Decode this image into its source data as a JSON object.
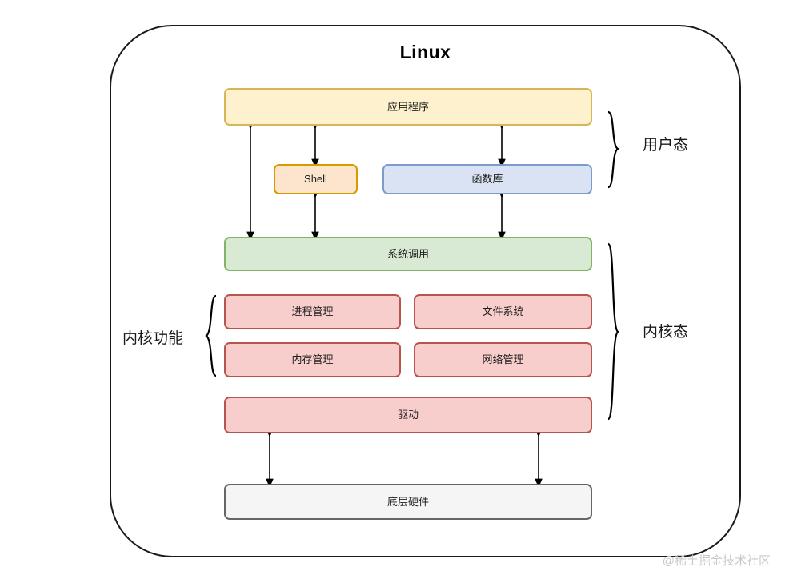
{
  "diagram": {
    "title": "Linux",
    "watermark": "@稀土掘金技术社区",
    "colors": {
      "frame_border": "#1a1a1a",
      "app_fill": "#fdf2cd",
      "app_border": "#d6b656",
      "shell_fill": "#fde5cd",
      "shell_border": "#d79b00",
      "lib_fill": "#dae3f3",
      "lib_border": "#7d9ccd",
      "syscall_fill": "#d8ead3",
      "syscall_border": "#82b366",
      "kernel_fill": "#f8cecc",
      "kernel_border": "#b85450",
      "hardware_fill": "#f5f5f5",
      "hardware_border": "#666666",
      "watermark_color": "#c9c9c9"
    },
    "nodes": {
      "application": "应用程序",
      "shell": "Shell",
      "library": "函数库",
      "syscall": "系统调用",
      "process_mgmt": "进程管理",
      "file_system": "文件系统",
      "memory_mgmt": "内存管理",
      "network_mgmt": "网络管理",
      "driver": "驱动",
      "hardware": "底层硬件"
    },
    "labels": {
      "user_mode": "用户态",
      "kernel_mode": "内核态",
      "kernel_functions": "内核功能"
    }
  }
}
